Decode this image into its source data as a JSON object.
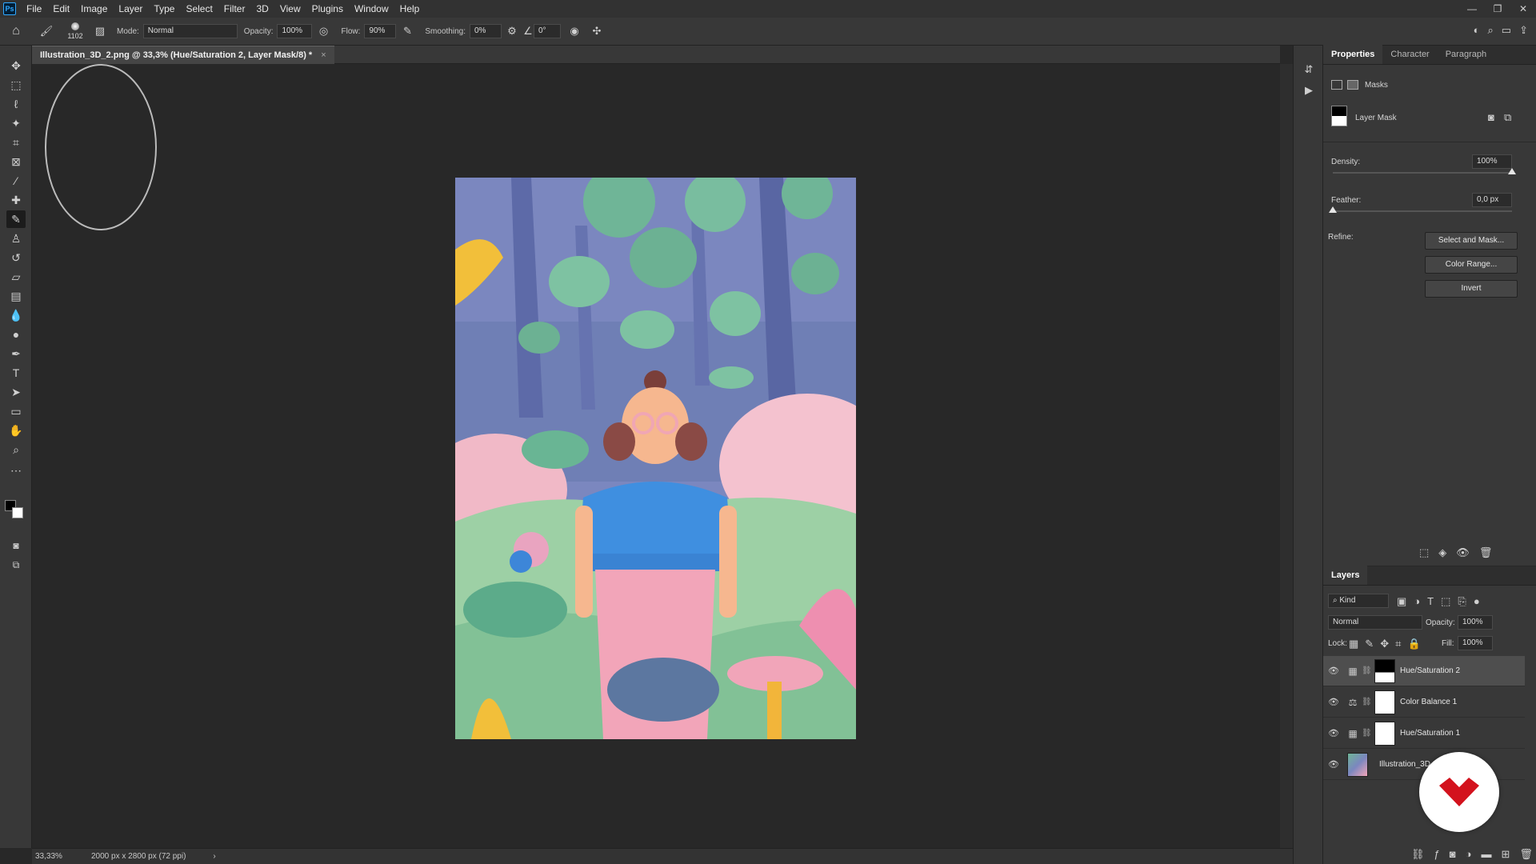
{
  "menubar": {
    "logo": "Ps",
    "items": [
      "File",
      "Edit",
      "Image",
      "Layer",
      "Type",
      "Select",
      "Filter",
      "3D",
      "View",
      "Plugins",
      "Window",
      "Help"
    ],
    "win_controls": [
      "—",
      "❐",
      "✕"
    ]
  },
  "options": {
    "brush_size": "1102",
    "mode_label": "Mode:",
    "mode_value": "Normal",
    "opacity_label": "Opacity:",
    "opacity_value": "100%",
    "flow_label": "Flow:",
    "flow_value": "90%",
    "smoothing_label": "Smoothing:",
    "smoothing_value": "0%",
    "angle_value": "0°"
  },
  "document": {
    "tab_title": "Illustration_3D_2.png @ 33,3% (Hue/Saturation 2, Layer Mask/8) *",
    "close": "×"
  },
  "status": {
    "zoom": "33,33%",
    "info": "2000 px x 2800 px (72 ppi)",
    "arrow": "›"
  },
  "properties": {
    "tabs": [
      "Properties",
      "Character",
      "Paragraph"
    ],
    "section": "Masks",
    "mask_label": "Layer Mask",
    "density_label": "Density:",
    "density_value": "100%",
    "density_level": 1.0,
    "feather_label": "Feather:",
    "feather_value": "0,0 px",
    "feather_level": 0.0,
    "refine_label": "Refine:",
    "buttons": [
      "Select and Mask...",
      "Color Range...",
      "Invert"
    ]
  },
  "layers": {
    "title": "Layers",
    "kind": "Kind",
    "blend": "Normal",
    "opacity_label": "Opacity:",
    "opacity_value": "100%",
    "lock_label": "Lock:",
    "fill_label": "Fill:",
    "fill_value": "100%",
    "items": [
      {
        "name": "Hue/Saturation 2",
        "selected": true
      },
      {
        "name": "Color Balance 1",
        "selected": false
      },
      {
        "name": "Hue/Saturation 1",
        "selected": false
      },
      {
        "name": "Illustration_3D",
        "selected": false
      }
    ]
  },
  "colors": {
    "foreground": "#000000",
    "background": "#ffffff",
    "accent": "#31a8ff",
    "watermark": "#d3121d"
  }
}
